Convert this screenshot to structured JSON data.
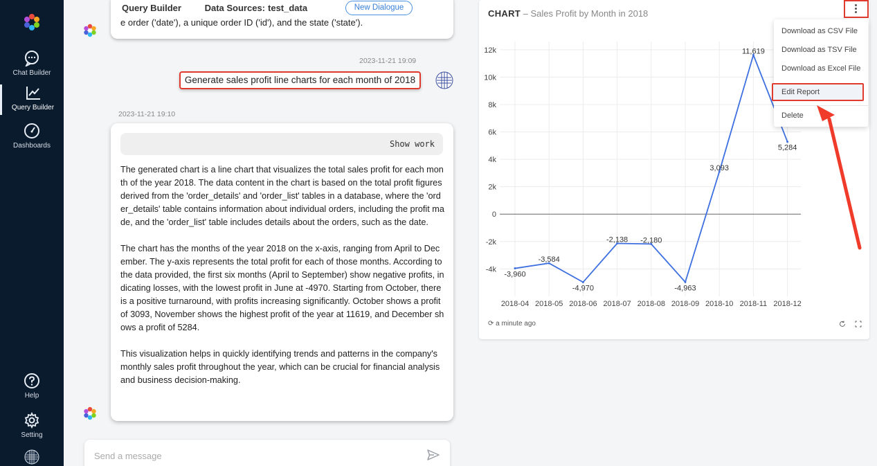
{
  "sidebar": {
    "items": [
      {
        "label": "Chat Builder",
        "icon": "chat-icon"
      },
      {
        "label": "Query Builder",
        "icon": "line-chart-icon"
      },
      {
        "label": "Dashboards",
        "icon": "gauge-icon"
      }
    ],
    "bottom": [
      {
        "label": "Help",
        "icon": "help-icon"
      },
      {
        "label": "Setting",
        "icon": "gear-icon"
      }
    ]
  },
  "header": {
    "title": "Query Builder",
    "data_sources_label": "Data Sources:",
    "data_sources_value": "test_data",
    "new_dialogue": "New Dialogue"
  },
  "chat": {
    "prev_message_tail": "e order ('date'), a unique order ID ('id'), and the state ('state').",
    "user_timestamp": "2023-11-21 19:09",
    "user_message": "Generate sales profit line charts for each month of 2018",
    "bot_timestamp": "2023-11-21 19:10",
    "show_work": "Show work",
    "answer_paragraphs": [
      "The generated chart is a line chart that visualizes the total sales profit for each month of the year 2018. The data content in the chart is based on the total profit figures derived from the 'order_details' and 'order_list' tables in a database, where the 'order_details' table contains information about individual orders, including the profit made, and the 'order_list' table includes details about the orders, such as the date.",
      "The chart has the months of the year 2018 on the x-axis, ranging from April to December. The y-axis represents the total profit for each of those months. According to the data provided, the first six months (April to September) show negative profits, indicating losses, with the lowest profit in June at -4970. Starting from October, there is a positive turnaround, with profits increasing significantly. October shows a profit of 3093, November shows the highest profit of the year at 11619, and December shows a profit of 5284.",
      "This visualization helps in quickly identifying trends and patterns in the company's monthly sales profit throughout the year, which can be crucial for financial analysis and business decision-making."
    ],
    "composer_placeholder": "Send a message"
  },
  "chart_panel": {
    "title_prefix": "CHART",
    "title_dash": " – ",
    "title": "Sales Profit by Month in 2018",
    "refreshed": "a minute ago",
    "menu": [
      "Download as CSV File",
      "Download as TSV File",
      "Download as Excel File",
      "Edit Report",
      "Delete"
    ]
  },
  "colors": {
    "sidebar_bg": "#0b1b2e",
    "accent_blue": "#4a90e2",
    "line_color": "#3d6fe0",
    "highlight_red": "#e03a2e"
  },
  "chart_data": {
    "type": "line",
    "title": "Sales Profit by Month in 2018",
    "categories": [
      "2018-04",
      "2018-05",
      "2018-06",
      "2018-07",
      "2018-08",
      "2018-09",
      "2018-10",
      "2018-11",
      "2018-12"
    ],
    "values": [
      -3960,
      -3584,
      -4970,
      -2138,
      -2180,
      -4963,
      3093,
      11619,
      5284
    ],
    "data_labels": [
      "-3,960",
      "-3,584",
      "-4,970",
      "-2,138",
      "-2,180",
      "-4,963",
      "3,093",
      "11,619",
      "5,284"
    ],
    "yticks": [
      -4000,
      -2000,
      0,
      2000,
      4000,
      6000,
      8000,
      10000,
      12000
    ],
    "ytick_labels": [
      "-4k",
      "-2k",
      "0",
      "2k",
      "4k",
      "6k",
      "8k",
      "10k",
      "12k"
    ],
    "ylim": [
      -5600,
      12600
    ],
    "grid": true
  }
}
